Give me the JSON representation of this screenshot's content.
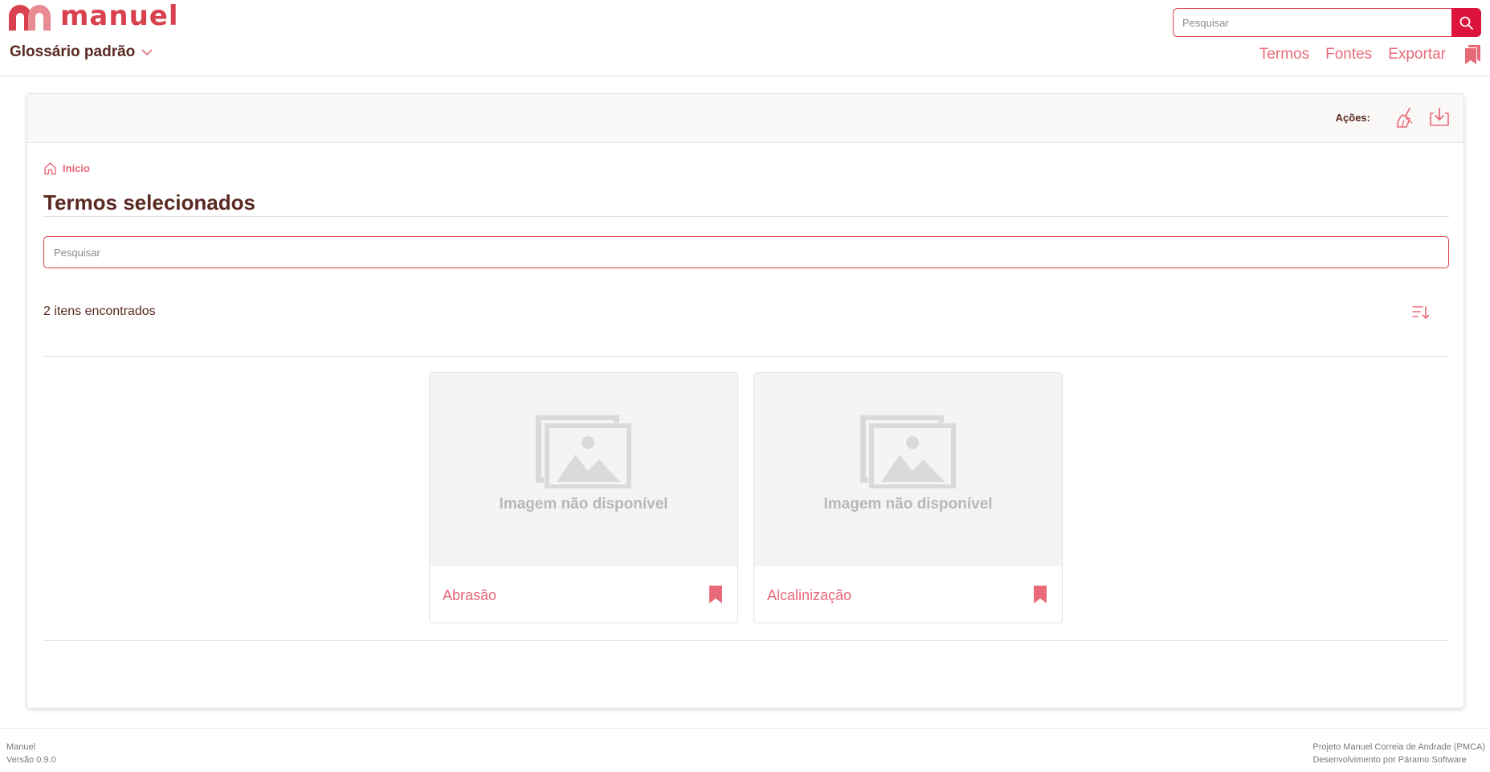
{
  "app": {
    "logo_text": "manuel",
    "glossary_label": "Glossário padrão"
  },
  "header": {
    "search_placeholder": "Pesquisar",
    "nav": {
      "terms": "Termos",
      "sources": "Fontes",
      "export": "Exportar"
    }
  },
  "toolbar": {
    "actions_label": "Ações:"
  },
  "breadcrumb": {
    "home": "Início"
  },
  "page": {
    "title": "Termos selecionados",
    "search_placeholder": "Pesquisar",
    "results_count": "2 itens encontrados"
  },
  "terms": [
    {
      "name": "Abrasão",
      "image_text": "Imagem não disponível"
    },
    {
      "name": "Alcalinização",
      "image_text": "Imagem não disponível"
    }
  ],
  "footer": {
    "app_name": "Manuel",
    "version": "Versão 0.9.0",
    "project": "Projeto Manuel Correia de Andrade (PMCA)",
    "developer": "Desenvolvimento por Páramo Software"
  },
  "colors": {
    "accent": "#dc143c",
    "link": "#e86a78",
    "text_dark": "#5a2a22"
  }
}
